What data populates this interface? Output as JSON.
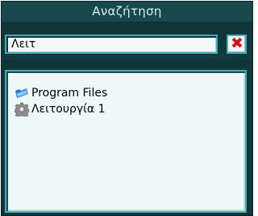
{
  "window": {
    "title": "Αναζήτηση"
  },
  "search": {
    "value": "Λειτ",
    "clear_icon": "close-icon",
    "clear_color": "#c8161d"
  },
  "results": [
    {
      "label": "Program Files",
      "icon": "folder-icon"
    },
    {
      "label": "Λειτουργία 1",
      "icon": "gear-icon"
    }
  ],
  "colors": {
    "frame": "#10363a",
    "title": "#17484c",
    "accent": "#4ea7b0",
    "list_bg": "#eef8f7"
  }
}
